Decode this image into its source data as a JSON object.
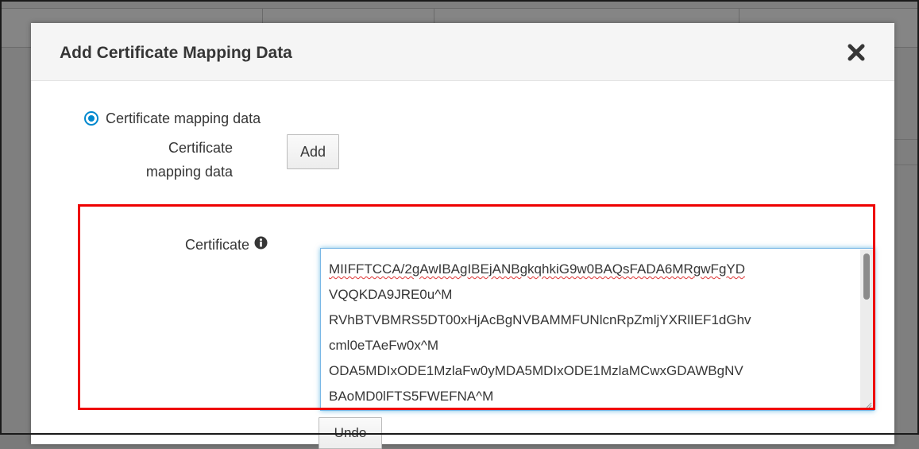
{
  "dialog": {
    "title": "Add Certificate Mapping Data",
    "close_icon": "close-icon"
  },
  "radio": {
    "label": "Certificate mapping data",
    "selected": true
  },
  "mapping_field": {
    "label": "Certificate mapping data",
    "add_label": "Add"
  },
  "certificate_field": {
    "label": "Certificate",
    "info_icon": "info-circle-icon",
    "lines": [
      "MIIFFTCCA/2gAwIBAgIBEjANBgkqhkiG9w0BAQsFADA6MRgwFgYD",
      "VQQKDA9JRE0u^M",
      "RVhBTVBMRS5DT00xHjAcBgNVBAMMFUNlcnRpZmljYXRlIEF1dGhv",
      "cml0eTAeFw0x^M",
      "ODA5MDIxODE1MzlaFw0yMDA5MDIxODE1MzlaMCwxGDAWBgNV",
      "BAoMD0lFTS5FWEFNA^M"
    ],
    "undo_label": "Undo"
  },
  "colors": {
    "accent": "#0088ce",
    "highlight_border": "#ee0000"
  }
}
